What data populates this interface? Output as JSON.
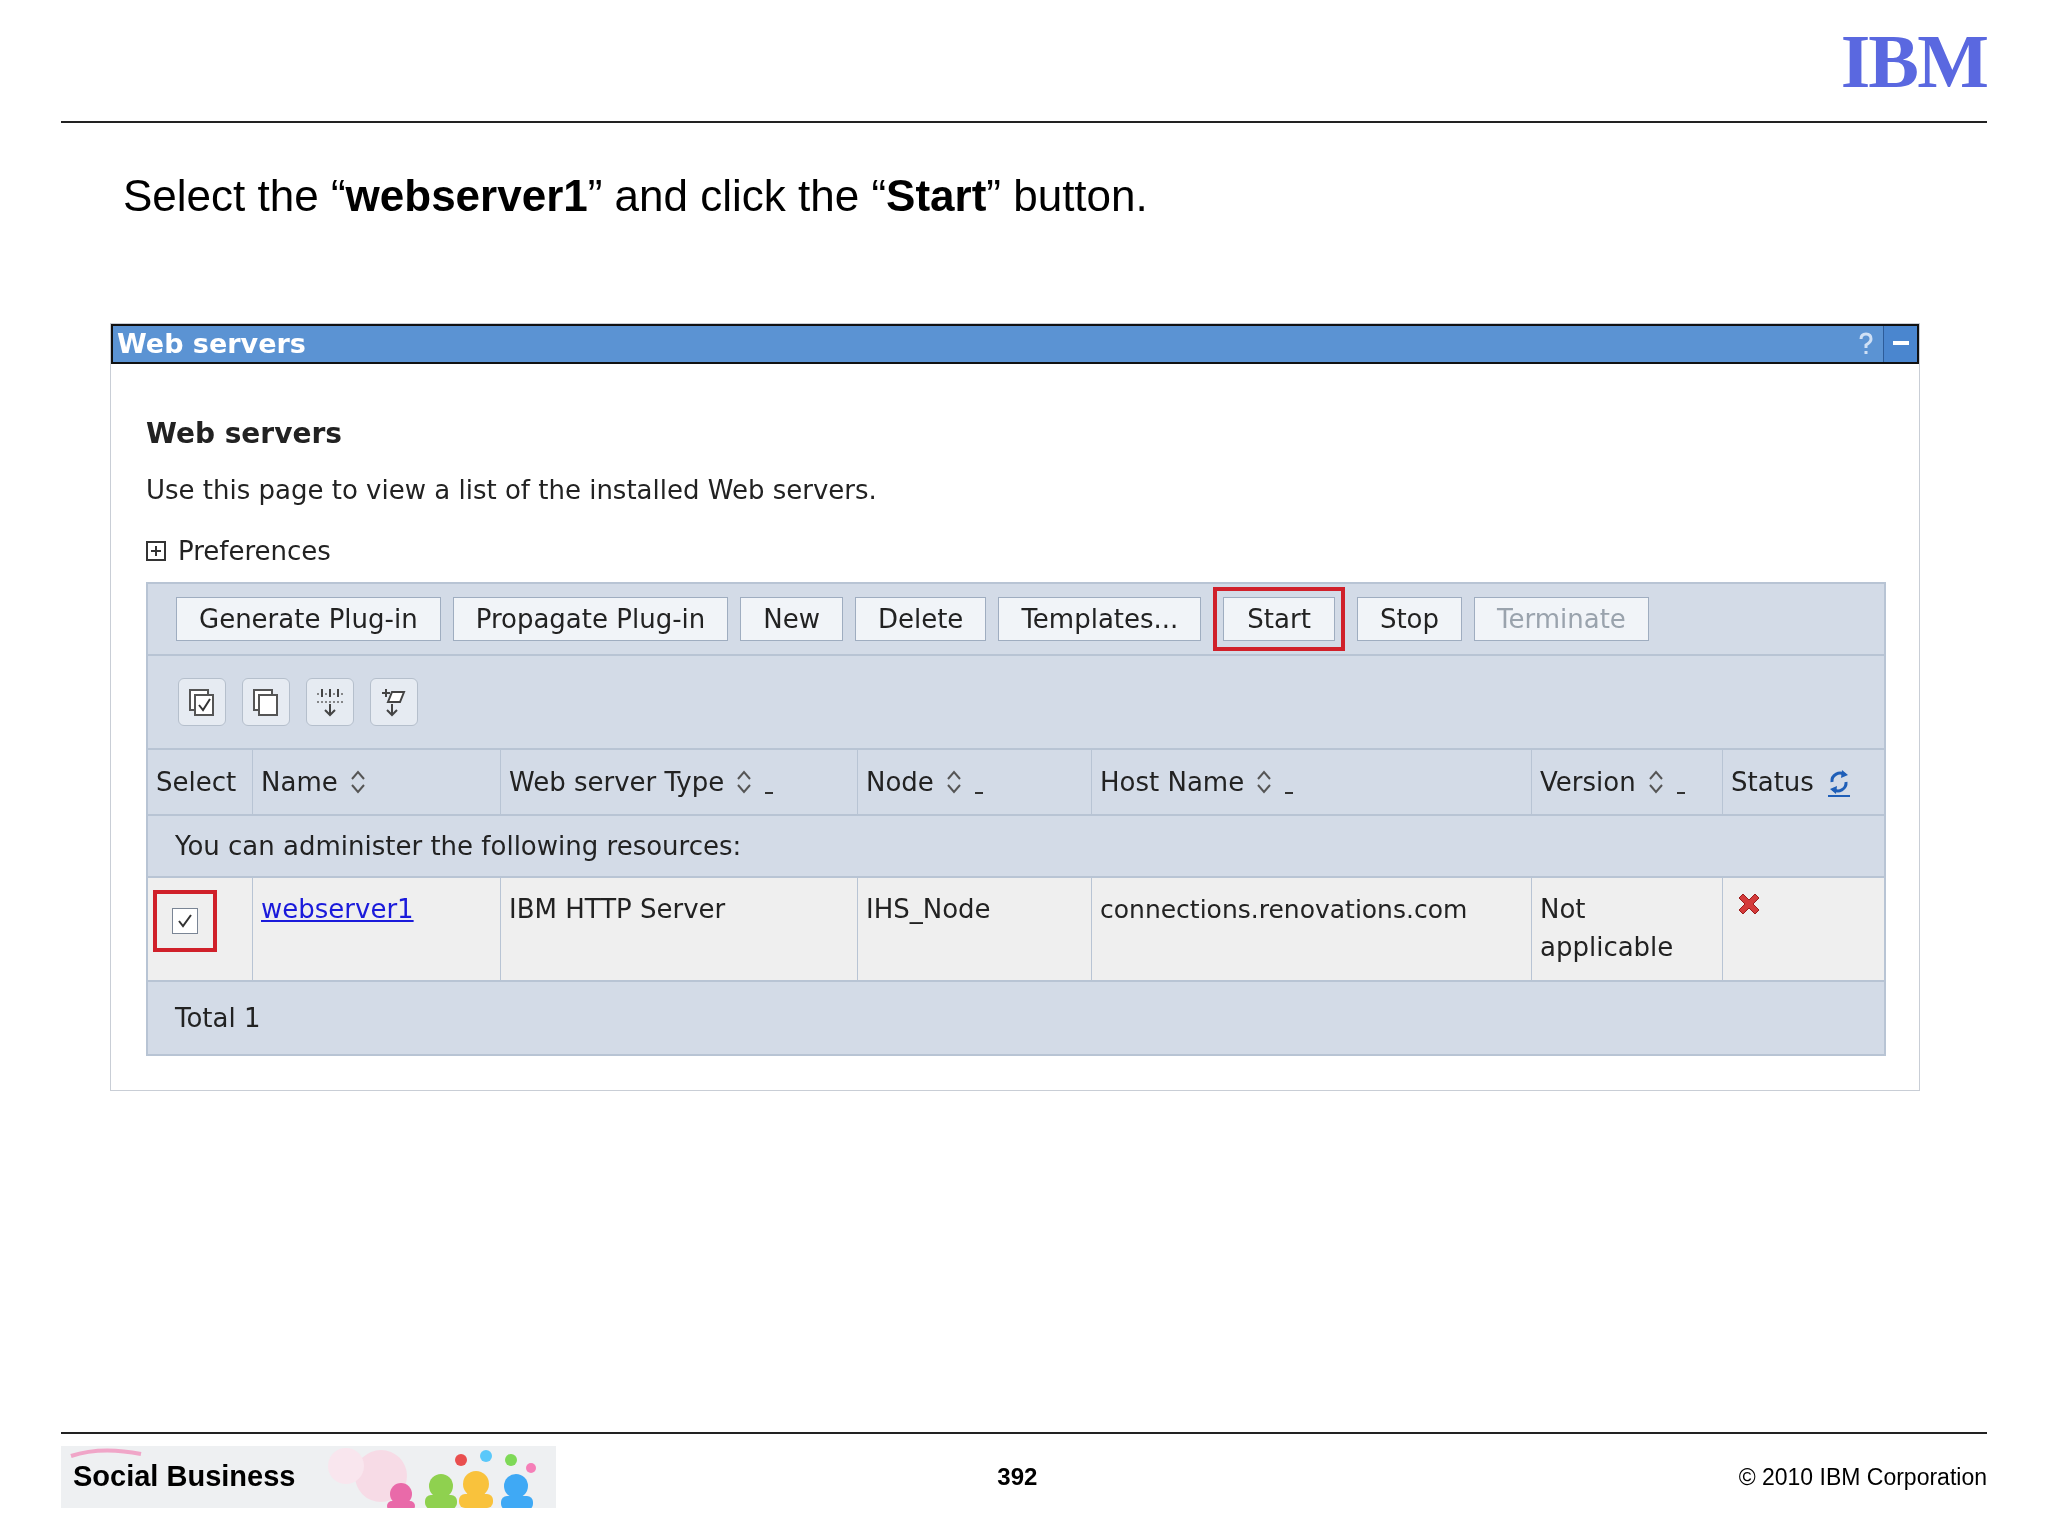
{
  "header": {
    "logo": "IBM"
  },
  "instruction": "Select the “**webserver1**” and click the “**Start**” button.",
  "window": {
    "title": "Web servers",
    "heading": "Web servers",
    "description": "Use this page to view a list of the installed Web servers.",
    "preferences": {
      "label": "Preferences",
      "expanded": false
    },
    "buttons": [
      {
        "label": "Generate Plug-in",
        "disabled": false,
        "highlighted": false
      },
      {
        "label": "Propagate Plug-in",
        "disabled": false,
        "highlighted": false
      },
      {
        "label": "New",
        "disabled": false,
        "highlighted": false
      },
      {
        "label": "Delete",
        "disabled": false,
        "highlighted": false
      },
      {
        "label": "Templates...",
        "disabled": false,
        "highlighted": false
      },
      {
        "label": "Start",
        "disabled": false,
        "highlighted": true
      },
      {
        "label": "Stop",
        "disabled": false,
        "highlighted": false
      },
      {
        "label": "Terminate",
        "disabled": true,
        "highlighted": false
      }
    ],
    "columns": [
      {
        "label": "Select",
        "kind": "plain"
      },
      {
        "label": "Name",
        "kind": "sort"
      },
      {
        "label": "Web server Type",
        "kind": "sort-filter"
      },
      {
        "label": "Node",
        "kind": "sort-filter"
      },
      {
        "label": "Host Name",
        "kind": "sort-filter"
      },
      {
        "label": "Version",
        "kind": "sort-filter"
      },
      {
        "label": "Status",
        "kind": "refresh"
      }
    ],
    "message": "You can administer the following resources:",
    "rows": [
      {
        "selected": true,
        "highlighted": true,
        "name": "webserver1",
        "type": "IBM HTTP Server",
        "node": "IHS_Node",
        "host": "connections.renovations.com",
        "version": "Not applicable",
        "running": false
      }
    ],
    "total": "Total 1"
  },
  "footer": {
    "brand": "Social Business",
    "page": "392",
    "copyright": "© 2010 IBM Corporation"
  }
}
